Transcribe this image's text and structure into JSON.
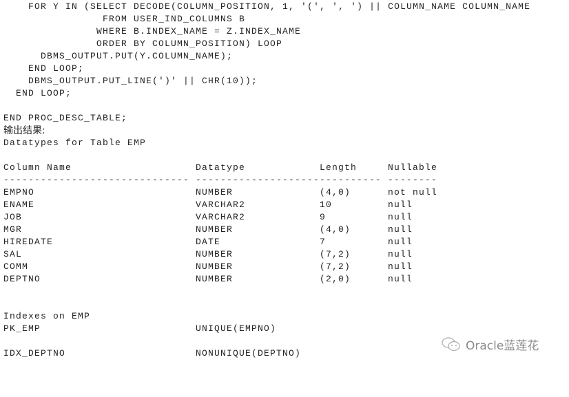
{
  "code_lines": [
    "    FOR Y IN (SELECT DECODE(COLUMN_POSITION, 1, '(', ', ') || COLUMN_NAME COLUMN_NAME",
    "                FROM USER_IND_COLUMNS B",
    "               WHERE B.INDEX_NAME = Z.INDEX_NAME",
    "               ORDER BY COLUMN_POSITION) LOOP",
    "      DBMS_OUTPUT.PUT(Y.COLUMN_NAME);",
    "    END LOOP;",
    "    DBMS_OUTPUT.PUT_LINE(')' || CHR(10));",
    "  END LOOP;",
    "",
    "END PROC_DESC_TABLE;"
  ],
  "output_label": "输出结果:",
  "table_title": "Datatypes for Table EMP",
  "columns": {
    "headers": [
      "Column Name",
      "Datatype",
      "Length",
      "Nullable"
    ],
    "separators": [
      "------------------------------",
      "--------------------",
      "----------",
      "--------"
    ],
    "rows": [
      [
        "EMPNO",
        "NUMBER",
        "(4,0)",
        "not null"
      ],
      [
        "ENAME",
        "VARCHAR2",
        "10",
        "null"
      ],
      [
        "JOB",
        "VARCHAR2",
        "9",
        "null"
      ],
      [
        "MGR",
        "NUMBER",
        "(4,0)",
        "null"
      ],
      [
        "HIREDATE",
        "DATE",
        "7",
        "null"
      ],
      [
        "SAL",
        "NUMBER",
        "(7,2)",
        "null"
      ],
      [
        "COMM",
        "NUMBER",
        "(7,2)",
        "null"
      ],
      [
        "DEPTNO",
        "NUMBER",
        "(2,0)",
        "null"
      ]
    ]
  },
  "indexes_title": "Indexes on EMP",
  "indexes": [
    [
      "PK_EMP",
      "UNIQUE(EMPNO)"
    ],
    [
      "IDX_DEPTNO",
      "NONUNIQUE(DEPTNO)"
    ]
  ],
  "watermark": {
    "text": "Oracle蓝莲花",
    "icon": "wechat-icon"
  }
}
